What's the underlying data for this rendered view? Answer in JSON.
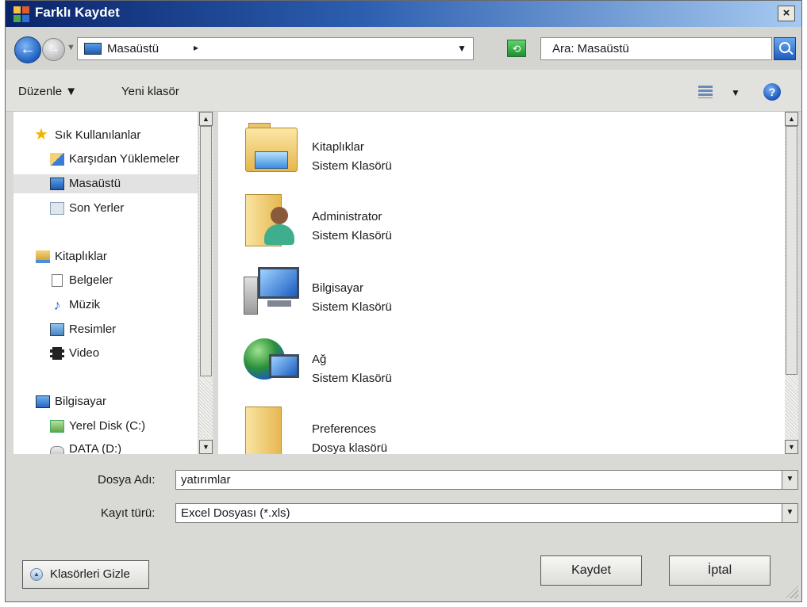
{
  "window": {
    "title": "Farklı Kaydet",
    "close_glyph": "×"
  },
  "address_bar": {
    "back_glyph": "←",
    "forward_glyph": "→",
    "path_label": "Masaüstü",
    "chevron": "▸",
    "dropdown": "▼",
    "refresh_glyph": "⟲",
    "search_placeholder": "Ara: Masaüstü"
  },
  "toolbar": {
    "organize_label": "Düzenle ▼",
    "new_folder_label": "Yeni klasör",
    "views_dropdown": "▼",
    "help_glyph": "?"
  },
  "nav_pane": {
    "favorites": "Sık Kullanılanlar",
    "downloads": "Karşıdan Yüklemeler",
    "desktop": "Masaüstü",
    "recent": "Son Yerler",
    "libraries": "Kitaplıklar",
    "documents": "Belgeler",
    "music": "Müzik",
    "pictures": "Resimler",
    "video": "Video",
    "computer": "Bilgisayar",
    "local_disk": "Yerel Disk (C:)",
    "data_disk": "DATA (D:)"
  },
  "scroll": {
    "up": "▲",
    "down": "▼"
  },
  "files": [
    {
      "name": "Kitaplıklar",
      "type": "Sistem Klasörü",
      "icon": "library-folder-icon"
    },
    {
      "name": "Administrator",
      "type": "Sistem Klasörü",
      "icon": "user-folder-icon"
    },
    {
      "name": "Bilgisayar",
      "type": "Sistem Klasörü",
      "icon": "computer-icon"
    },
    {
      "name": "Ağ",
      "type": "Sistem Klasörü",
      "icon": "network-icon"
    },
    {
      "name": "Preferences",
      "type": "Dosya klasörü",
      "icon": "folder-icon"
    }
  ],
  "form": {
    "filename_label": "Dosya Adı:",
    "filename_value": "yatırımlar",
    "filetype_label": "Kayıt türü:",
    "filetype_value": "Excel Dosyası (*.xls)",
    "combo_arrow": "▼"
  },
  "buttons": {
    "hide_folders": "Klasörleri Gizle",
    "hide_folders_glyph": "▲",
    "save": "Kaydet",
    "cancel": "İptal"
  },
  "colors": {
    "title_bar": "#0a246a",
    "accent": "#1d5fc1",
    "dialog_bg": "#d9d9d5"
  }
}
